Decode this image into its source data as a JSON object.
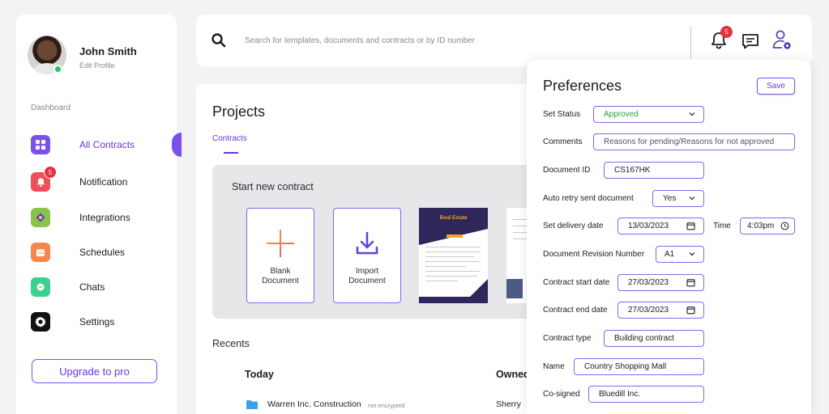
{
  "sidebar": {
    "profile_name": "John Smith",
    "edit_profile": "Edit Profile",
    "section_label": "Dashboard",
    "items": [
      {
        "label": "All Contracts",
        "icon": "grid-icon",
        "color": "#7c4ff0",
        "active": true
      },
      {
        "label": "Notification",
        "icon": "bell-icon",
        "color": "#f04f5a",
        "badge": "5"
      },
      {
        "label": "Integrations",
        "icon": "integrations-icon",
        "color": "#8bc34a"
      },
      {
        "label": "Schedules",
        "icon": "calendar-icon",
        "color": "#f5874a"
      },
      {
        "label": "Chats",
        "icon": "chat-icon",
        "color": "#3ecf8e"
      },
      {
        "label": "Settings",
        "icon": "gear-icon",
        "color": "#111111"
      }
    ],
    "upgrade_label": "Upgrade to pro"
  },
  "topbar": {
    "search_placeholder": "Search for templates, documents and contracts or by ID number",
    "notification_count": "5"
  },
  "main": {
    "title": "Projects",
    "tab_label": "Contracts",
    "start_title": "Start new contract",
    "cards": [
      {
        "label": "Blank Document",
        "icon": "plus-icon"
      },
      {
        "label": "Import Document",
        "icon": "download-icon"
      }
    ],
    "template_title": "Real Estate",
    "recents_title": "Recents",
    "today_label": "Today",
    "owned_label": "Owned",
    "files": [
      {
        "name": "Warren Inc. Construction",
        "encryption": "not encrypted",
        "owner": "Sherry"
      }
    ]
  },
  "preferences": {
    "title": "Preferences",
    "save_label": "Save",
    "set_status_label": "Set Status",
    "set_status_value": "Approved",
    "comments_label": "Comments",
    "comments_placeholder": "Reasons for pending/Reasons for not approved",
    "document_id_label": "Document ID",
    "document_id_value": "CS167HK",
    "auto_retry_label": "Auto retry sent document",
    "auto_retry_value": "Yes",
    "delivery_date_label": "Set delivery date",
    "delivery_date_value": "13/03/2023",
    "time_label": "Time",
    "time_value": "4:03pm",
    "revision_label": "Document Revision Number",
    "revision_value": "A1",
    "start_date_label": "Contract start date",
    "start_date_value": "27/03/2023",
    "end_date_label": "Contract end date",
    "end_date_value": "27/03/2023",
    "contract_type_label": "Contract type",
    "contract_type_value": "Building contract",
    "name_label": "Name",
    "name_value": "Country Shopping Mall",
    "cosigned_label": "Co-signed",
    "cosigned_value": "Bluedill Inc."
  },
  "colors": {
    "accent": "#7c4ff0",
    "approved": "#22a83a",
    "badge": "#e8313e"
  }
}
